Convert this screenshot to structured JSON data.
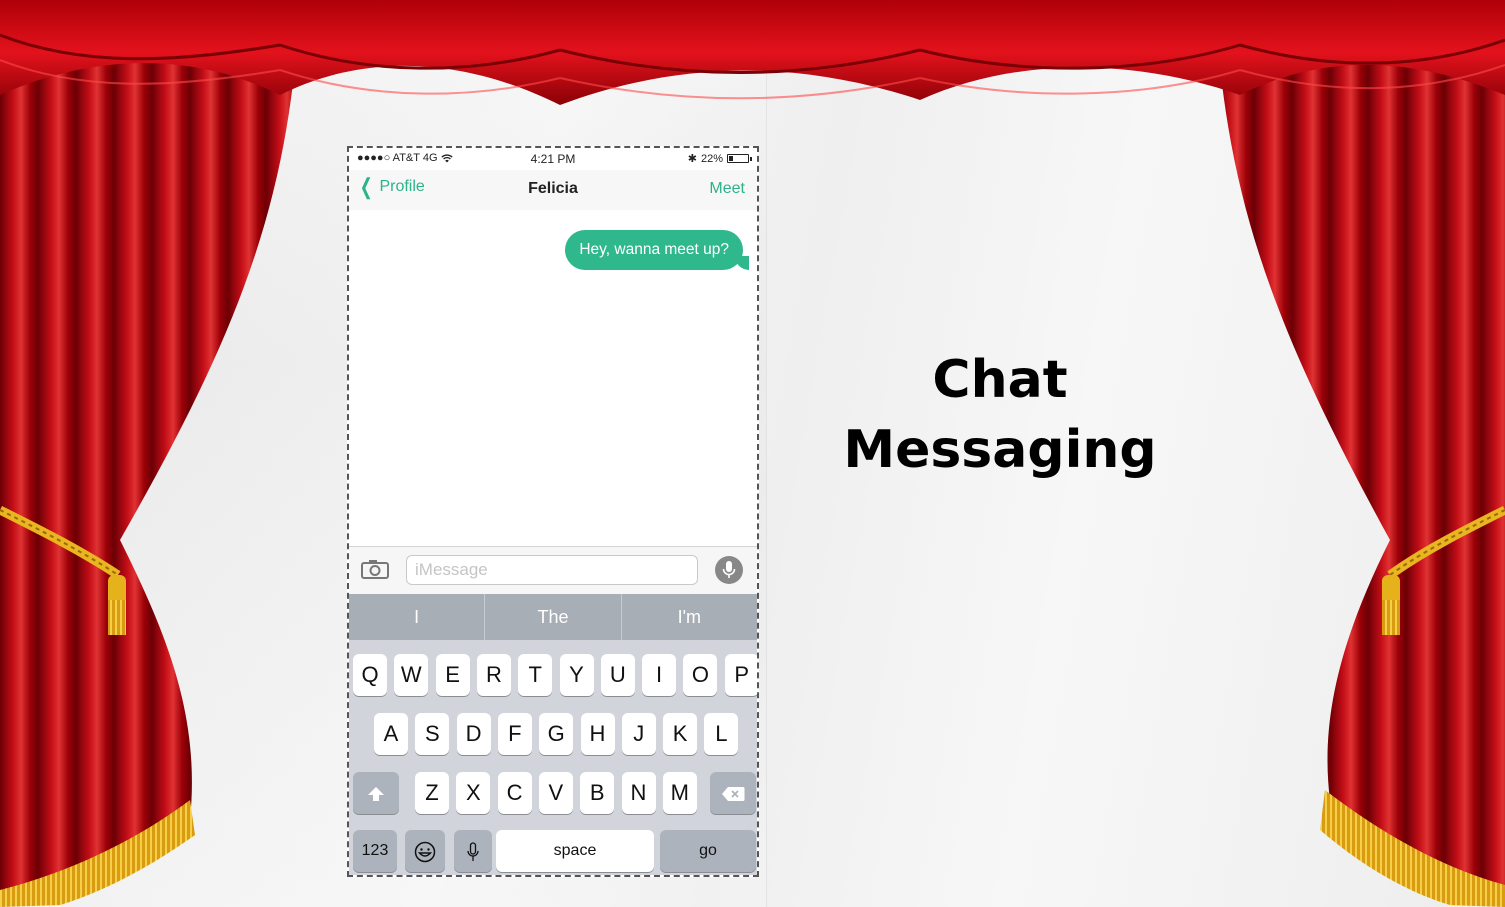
{
  "status": {
    "carrier": "●●●●○ AT&T 4G",
    "time": "4:21 PM",
    "bluetooth": "✱",
    "battery": "22%",
    "battery_level": 0.22
  },
  "nav": {
    "back_label": "Profile",
    "title": "Felicia",
    "action_label": "Meet"
  },
  "messages": [
    {
      "text": "Hey, wanna meet up?",
      "outgoing": true
    }
  ],
  "composer": {
    "placeholder": "iMessage",
    "value": ""
  },
  "suggestions": [
    "I",
    "The",
    "I'm"
  ],
  "keyboard": {
    "row1": [
      "Q",
      "W",
      "E",
      "R",
      "T",
      "Y",
      "U",
      "I",
      "O",
      "P"
    ],
    "row2": [
      "A",
      "S",
      "D",
      "F",
      "G",
      "H",
      "J",
      "K",
      "L"
    ],
    "row3": [
      "Z",
      "X",
      "C",
      "V",
      "B",
      "N",
      "M"
    ],
    "numbers_label": "123",
    "space_label": "space",
    "go_label": "go"
  },
  "slide": {
    "title_line1": "Chat",
    "title_line2": "Messaging"
  },
  "colors": {
    "accent": "#2fb88c",
    "curtain": "#c8000c",
    "fringe": "#e8b11a"
  }
}
